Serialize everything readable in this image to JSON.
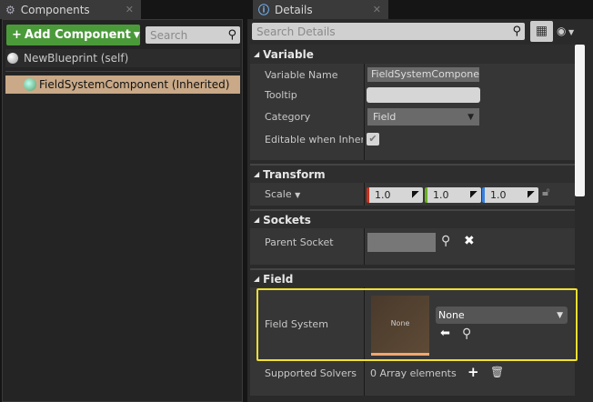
{
  "components": {
    "tab_title": "Components",
    "add_button": "Add Component",
    "search_placeholder": "Search",
    "items": [
      {
        "label": "NewBlueprint (self)"
      },
      {
        "label": "FieldSystemComponent (Inherited)"
      }
    ]
  },
  "details": {
    "tab_title": "Details",
    "search_placeholder": "Search Details",
    "sections": {
      "variable": {
        "title": "Variable",
        "variable_name_label": "Variable Name",
        "variable_name_value": "FieldSystemComponen",
        "tooltip_label": "Tooltip",
        "tooltip_value": "",
        "category_label": "Category",
        "category_value": "Field",
        "editable_label": "Editable when Inherited",
        "editable_checked": true
      },
      "transform": {
        "title": "Transform",
        "scale_label": "Scale",
        "scale_x": "1.0",
        "scale_y": "1.0",
        "scale_z": "1.0"
      },
      "sockets": {
        "title": "Sockets",
        "parent_socket_label": "Parent Socket"
      },
      "field": {
        "title": "Field",
        "field_system_label": "Field System",
        "thumbnail_text": "None",
        "field_system_value": "None",
        "supported_solvers_label": "Supported Solvers",
        "supported_solvers_value": "0 Array elements"
      }
    }
  },
  "colors": {
    "add_green": "#4b9a3a",
    "selected_row": "#c9a987",
    "highlight": "#f0e030"
  }
}
